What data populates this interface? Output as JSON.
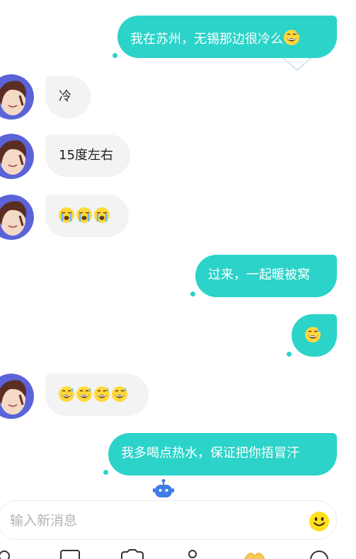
{
  "messages": [
    {
      "direction": "out",
      "text": "我在苏州，无锡那边很冷么",
      "emoji": [
        "sweat-smile"
      ]
    },
    {
      "direction": "in",
      "text": "冷",
      "emoji": []
    },
    {
      "direction": "in",
      "text": "15度左右",
      "emoji": []
    },
    {
      "direction": "in",
      "text": "",
      "emoji": [
        "crying",
        "crying",
        "crying"
      ]
    },
    {
      "direction": "out",
      "text": "过来，一起暖被窝",
      "emoji": []
    },
    {
      "direction": "out",
      "text": "",
      "emoji": [
        "sweat-smile"
      ]
    },
    {
      "direction": "in",
      "text": "",
      "emoji": [
        "sweat-smile",
        "sweat-smile",
        "sweat-smile",
        "sweat-smile"
      ]
    },
    {
      "direction": "out",
      "text": "我多喝点热水，保证把你捂冒汗",
      "emoji": []
    }
  ],
  "composer": {
    "placeholder": "输入新消息",
    "emoji_button_icon": "smiley-icon"
  },
  "icons": {
    "assistant": "robot-icon",
    "tabbar": [
      "profile-icon",
      "mail-icon",
      "camera-icon",
      "user-icon",
      "gift-icon",
      "help-icon"
    ]
  },
  "colors": {
    "outgoing_bubble": "#2bd3c9",
    "incoming_bubble": "#f3f3f3",
    "assistant_icon": "#3f7de6",
    "emoji_yellow": "#ffd93b"
  }
}
